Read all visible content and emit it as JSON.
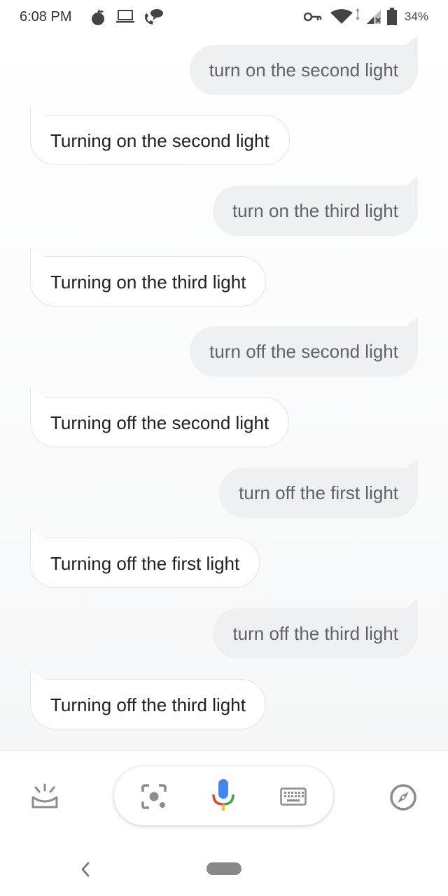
{
  "status_bar": {
    "time": "6:08 PM",
    "battery": "34%",
    "icons": [
      "fruit-icon",
      "laptop-icon",
      "phone-message-icon",
      "vpn-key-icon",
      "wifi-icon",
      "signal-icon",
      "battery-icon"
    ]
  },
  "conversation": [
    {
      "role": "user",
      "text": "turn on the second light"
    },
    {
      "role": "assistant",
      "text": "Turning on the second light"
    },
    {
      "role": "user",
      "text": "turn on the third light"
    },
    {
      "role": "assistant",
      "text": "Turning on the third light"
    },
    {
      "role": "user",
      "text": "turn off the second light"
    },
    {
      "role": "assistant",
      "text": "Turning off the second light"
    },
    {
      "role": "user",
      "text": "turn off the first light"
    },
    {
      "role": "assistant",
      "text": "Turning off the first light"
    },
    {
      "role": "user",
      "text": "turn off the third light"
    },
    {
      "role": "assistant",
      "text": "Turning off the third light"
    }
  ],
  "bottom_bar": {
    "icons": [
      "snapshot-icon",
      "lens-icon",
      "microphone-icon",
      "keyboard-icon",
      "explore-compass-icon"
    ]
  },
  "nav_bar": {
    "icons": [
      "back-icon",
      "home-pill"
    ]
  },
  "colors": {
    "user_bubble": "#eff0f2",
    "assistant_border": "#e3e5e8",
    "mic_blue": "#4285f4",
    "mic_red": "#ea4335",
    "mic_yellow": "#fbbc05",
    "mic_green": "#34a853",
    "icon_gray": "#8a8d91"
  }
}
